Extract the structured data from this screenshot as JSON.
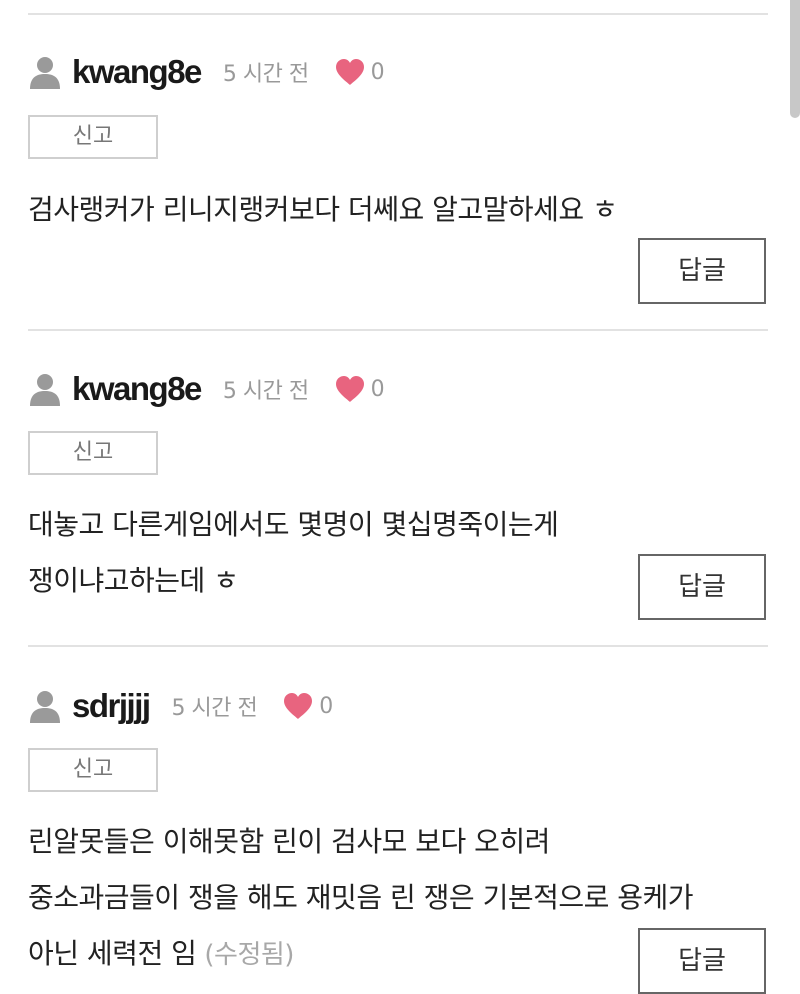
{
  "colors": {
    "heart": "#e8647f",
    "avatar": "#9a9a9a",
    "divider": "#e2e2e2"
  },
  "comments": [
    {
      "username": "kwang8e",
      "time": "5 시간 전",
      "likes": "0",
      "report_label": "신고",
      "lines": [
        "검사랭커가 리니지랭커보다 더쎄요 알고말하세요 ㅎ"
      ],
      "edited": "",
      "reply_label": "답글"
    },
    {
      "username": "kwang8e",
      "time": "5 시간 전",
      "likes": "0",
      "report_label": "신고",
      "lines": [
        "대놓고 다른게임에서도 몇명이 몇십명죽이는게",
        "쟁이냐고하는데 ㅎ"
      ],
      "edited": "",
      "reply_label": "답글"
    },
    {
      "username": "sdrjjjj",
      "time": "5 시간 전",
      "likes": "0",
      "report_label": "신고",
      "lines": [
        "린알못들은 이해못함 린이 검사모 보다 오히려",
        "중소과금들이 쟁을 해도 재밋음 린 쟁은 기본적으로 용케가",
        "아닌 세력전 임"
      ],
      "edited": "(수정됨)",
      "reply_label": "답글"
    }
  ]
}
